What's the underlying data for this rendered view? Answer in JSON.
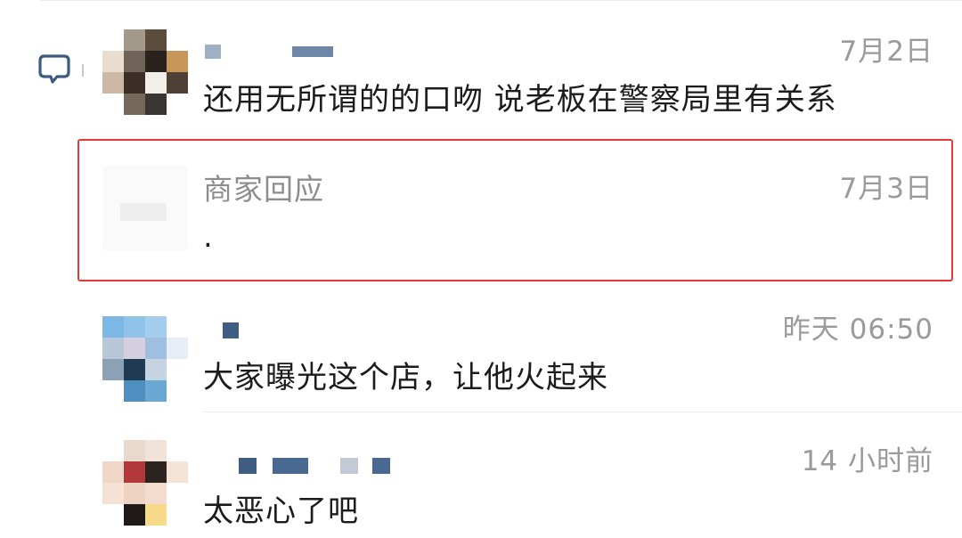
{
  "comments": [
    {
      "text": "还用无所谓的的口吻 说老板在警察局里有关系",
      "time": "7月2日"
    },
    {
      "text": "大家曝光这个店，让他火起来",
      "time": "昨天 06:50"
    },
    {
      "text": "太恶心了吧",
      "time": "14 小时前"
    }
  ],
  "merchant_reply": {
    "label": "商家回应",
    "time": "7月3日",
    "text": "."
  },
  "colors": {
    "highlight_border": "#e53935",
    "timestamp": "#9a9a9a",
    "body_text": "#1c1c1c",
    "icon": "#3d5a80"
  },
  "icons": {
    "comment": "speech-bubble-icon"
  }
}
